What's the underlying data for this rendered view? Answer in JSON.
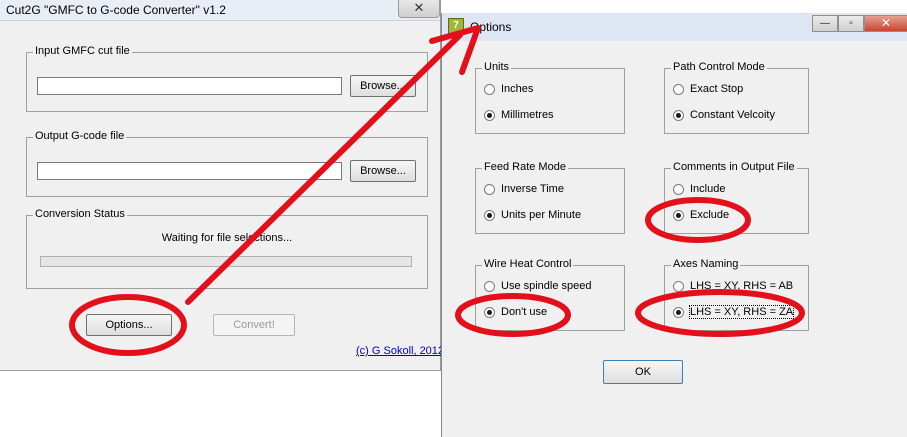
{
  "main_window": {
    "title": "Cut2G \"GMFC to G-code Converter\" v1.2",
    "close_glyph": "✕",
    "input_group": {
      "legend": "Input GMFC cut file",
      "value": "",
      "browse_label": "Browse..."
    },
    "output_group": {
      "legend": "Output G-code file",
      "value": "",
      "browse_label": "Browse..."
    },
    "status_group": {
      "legend": "Conversion Status",
      "status_text": "Waiting for file selections...",
      "progress": 0
    },
    "options_label": "Options...",
    "convert_label": "Convert!",
    "credit": "(c) G Sokoll, 2012"
  },
  "options_dialog": {
    "title": "Options",
    "icon_glyph": "7",
    "minimize_glyph": "—",
    "maximize_glyph": "▫",
    "close_glyph": "✕",
    "groups": {
      "units": {
        "legend": "Units",
        "options": [
          "Inches",
          "Millimetres"
        ],
        "selected": 1
      },
      "path_control": {
        "legend": "Path Control Mode",
        "options": [
          "Exact Stop",
          "Constant Velcoity"
        ],
        "selected": 1
      },
      "feed_rate": {
        "legend": "Feed Rate Mode",
        "options": [
          "Inverse Time",
          "Units per Minute"
        ],
        "selected": 1
      },
      "comments": {
        "legend": "Comments in Output File",
        "options": [
          "Include",
          "Exclude"
        ],
        "selected": 1
      },
      "wire_heat": {
        "legend": "Wire Heat Control",
        "options": [
          "Use spindle speed",
          "Don't use"
        ],
        "selected": 1
      },
      "axes_naming": {
        "legend": "Axes Naming",
        "options": [
          "LHS = XY, RHS = AB",
          "LHS = XY, RHS = ZA"
        ],
        "selected": 1
      }
    },
    "ok_label": "OK"
  },
  "annotation": {
    "color": "#e3101b"
  }
}
